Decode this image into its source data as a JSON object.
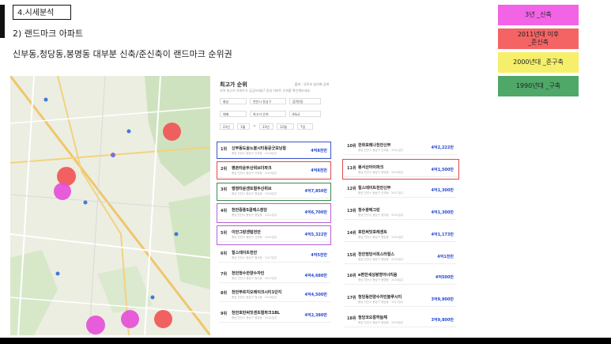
{
  "section": "4.시세분석",
  "subtitle": "2) 랜드마크 아파트",
  "summary": "신부동,청당동,봉명동 대부분 신축/준신축이 랜드마크 순위권",
  "legend": [
    {
      "label": "3년 _신축",
      "color": "#f263e6"
    },
    {
      "label": "2011년대 이후\n_준신축",
      "color": "#f46464"
    },
    {
      "label": "2000년대 _준구축",
      "color": "#f6ef6b"
    },
    {
      "label": "1990년대 _구축",
      "color": "#4fa868"
    }
  ],
  "panel": {
    "title": "최고가 순위",
    "source": "출처 : 국토부 실거래 공개",
    "desc": "지역 최고가 아파트가 궁금하세요? 동네 아파트 순위를 확인해보세요.",
    "filters": [
      "충남",
      "천안시 동남구",
      "읍/면/동",
      "매매",
      "최고가 순위",
      "84㎡",
      "23년",
      "1월",
      "~",
      "23년",
      "12월",
      "7일"
    ]
  },
  "ranks_left": [
    {
      "rank": "1위",
      "name": "신부동도솔노블시티동문굿모닝힐",
      "sub": "충남 천안시 동남구 신부동 · 2018입주",
      "price": "4억8천만"
    },
    {
      "rank": "2위",
      "name": "평촌타운두산위브더파크",
      "sub": "충남 천안시 동남구 신방동 · 2019입주",
      "price": "4억8천만"
    },
    {
      "rank": "3위",
      "name": "행정타운센트럴두산위브",
      "sub": "충남 천안시 동남구 청당동 · 2016입주",
      "price": "4억7,850만"
    },
    {
      "rank": "4위",
      "name": "천안중흥S클래스청당",
      "sub": "충남 천안시 동남구 청당동 · 2021입주",
      "price": "4억6,700만"
    },
    {
      "rank": "5위",
      "name": "이안그랑센텀천안",
      "sub": "충남 천안시 동남구 신부동 · 2021입주",
      "price": "4억5,322만"
    },
    {
      "rank": "6위",
      "name": "힐스테이트천안",
      "sub": "충남 천안시 동남구 청수동 · 2017입주",
      "price": "4억5천만"
    },
    {
      "rank": "7위",
      "name": "천안청수한양수자인",
      "sub": "충남 천안시 동남구 청수동 · 2017입주",
      "price": "4억4,680만"
    },
    {
      "rank": "8위",
      "name": "천안푸르지오레이크시티1단지",
      "sub": "충남 천안시 동남구 청수동 · 2016입주",
      "price": "4억4,500만"
    },
    {
      "rank": "9위",
      "name": "천안호반써밋센트럴파크1BL",
      "sub": "충남 천안시 동남구 청당동 · 2021입주",
      "price": "4억2,380만"
    }
  ],
  "ranks_right": [
    {
      "rank": "10위",
      "name": "한화포레나천안신부",
      "sub": "충남 천안시 동남구 신부동 · 2021입주",
      "price": "4억2,222만"
    },
    {
      "rank": "11위",
      "name": "봉서산아이파크",
      "sub": "충남 천안시 동남구 청당동 · 2019입주",
      "price": "4억1,500만"
    },
    {
      "rank": "12위",
      "name": "힐스테이트천안신부",
      "sub": "충남 천안시 동남구 신부동 · 2017입주",
      "price": "4억1,300만"
    },
    {
      "rank": "13위",
      "name": "청수광에그린",
      "sub": "충남 천안시 동남구 청수동 · 2021입주",
      "price": "4억1,300만"
    },
    {
      "rank": "14위",
      "name": "호반써밋포레센트",
      "sub": "충남 천안시 동남구 청당동 · 2021입주",
      "price": "4억1,173만"
    },
    {
      "rank": "15위",
      "name": "천안청당서희스타힐스",
      "sub": "충남 천안시 동남구 청당동 · 2022입주",
      "price": "4억1천만"
    },
    {
      "rank": "16위",
      "name": "e편한세상봉명아너리움",
      "sub": "충남 천안시 동남구 봉명동 · 2020입주",
      "price": "4억500만"
    },
    {
      "rank": "17위",
      "name": "청당동한양수자인블루시티",
      "sub": "충남 천안시 동남구 청당동 · 2017입주",
      "price": "3억9,900만"
    },
    {
      "rank": "18위",
      "name": "청당코오롱하늘채",
      "sub": "충남 천안시 동남구 청당동 · 2019입주",
      "price": "3억9,800만"
    }
  ]
}
